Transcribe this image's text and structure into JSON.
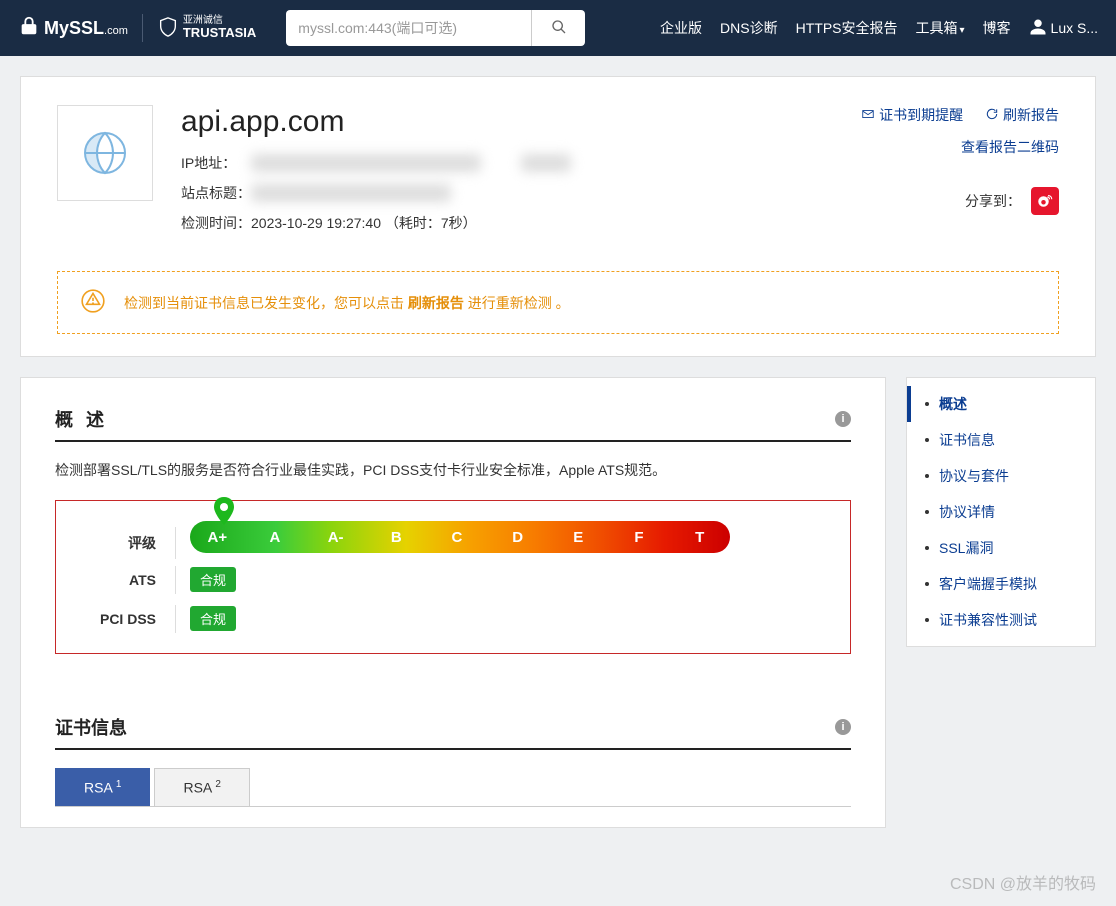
{
  "header": {
    "logo1_text": "MySSL",
    "logo1_suffix": ".com",
    "logo2_cn": "亚洲诚信",
    "logo2_en": "TRUSTASIA",
    "search_placeholder": "myssl.com:443(端口可选)",
    "nav": [
      "企业版",
      "DNS诊断",
      "HTTPS安全报告",
      "工具箱",
      "博客"
    ],
    "user": "Lux S..."
  },
  "card": {
    "domain": "api.app.com",
    "ip_label": "IP地址：",
    "title_label": "站点标题：",
    "time_label": "检测时间：",
    "time_value": "2023-10-29 19:27:40  （耗时：7秒）",
    "actions": {
      "expiry": "证书到期提醒",
      "refresh": "刷新报告",
      "qr": "查看报告二维码"
    },
    "share_label": "分享到："
  },
  "alert": {
    "text_before": "检测到当前证书信息已发生变化，您可以点击 ",
    "bold": "刷新报告",
    "text_after": " 进行重新检测 。"
  },
  "sidebar": [
    "概述",
    "证书信息",
    "协议与套件",
    "协议详情",
    "SSL漏洞",
    "客户端握手模拟",
    "证书兼容性测试"
  ],
  "overview": {
    "title": "概 述",
    "desc": "检测部署SSL/TLS的服务是否符合行业最佳实践，PCI DSS支付卡行业安全标准，Apple ATS规范。",
    "rating_label": "评级",
    "grades": [
      "A+",
      "A",
      "A-",
      "B",
      "C",
      "D",
      "E",
      "F",
      "T"
    ],
    "ats_label": "ATS",
    "ats_badge": "合规",
    "pci_label": "PCI DSS",
    "pci_badge": "合规"
  },
  "cert": {
    "title": "证书信息",
    "tab1": "RSA",
    "tab1_sup": "1",
    "tab2": "RSA",
    "tab2_sup": "2"
  },
  "watermark": "CSDN @放羊的牧码"
}
